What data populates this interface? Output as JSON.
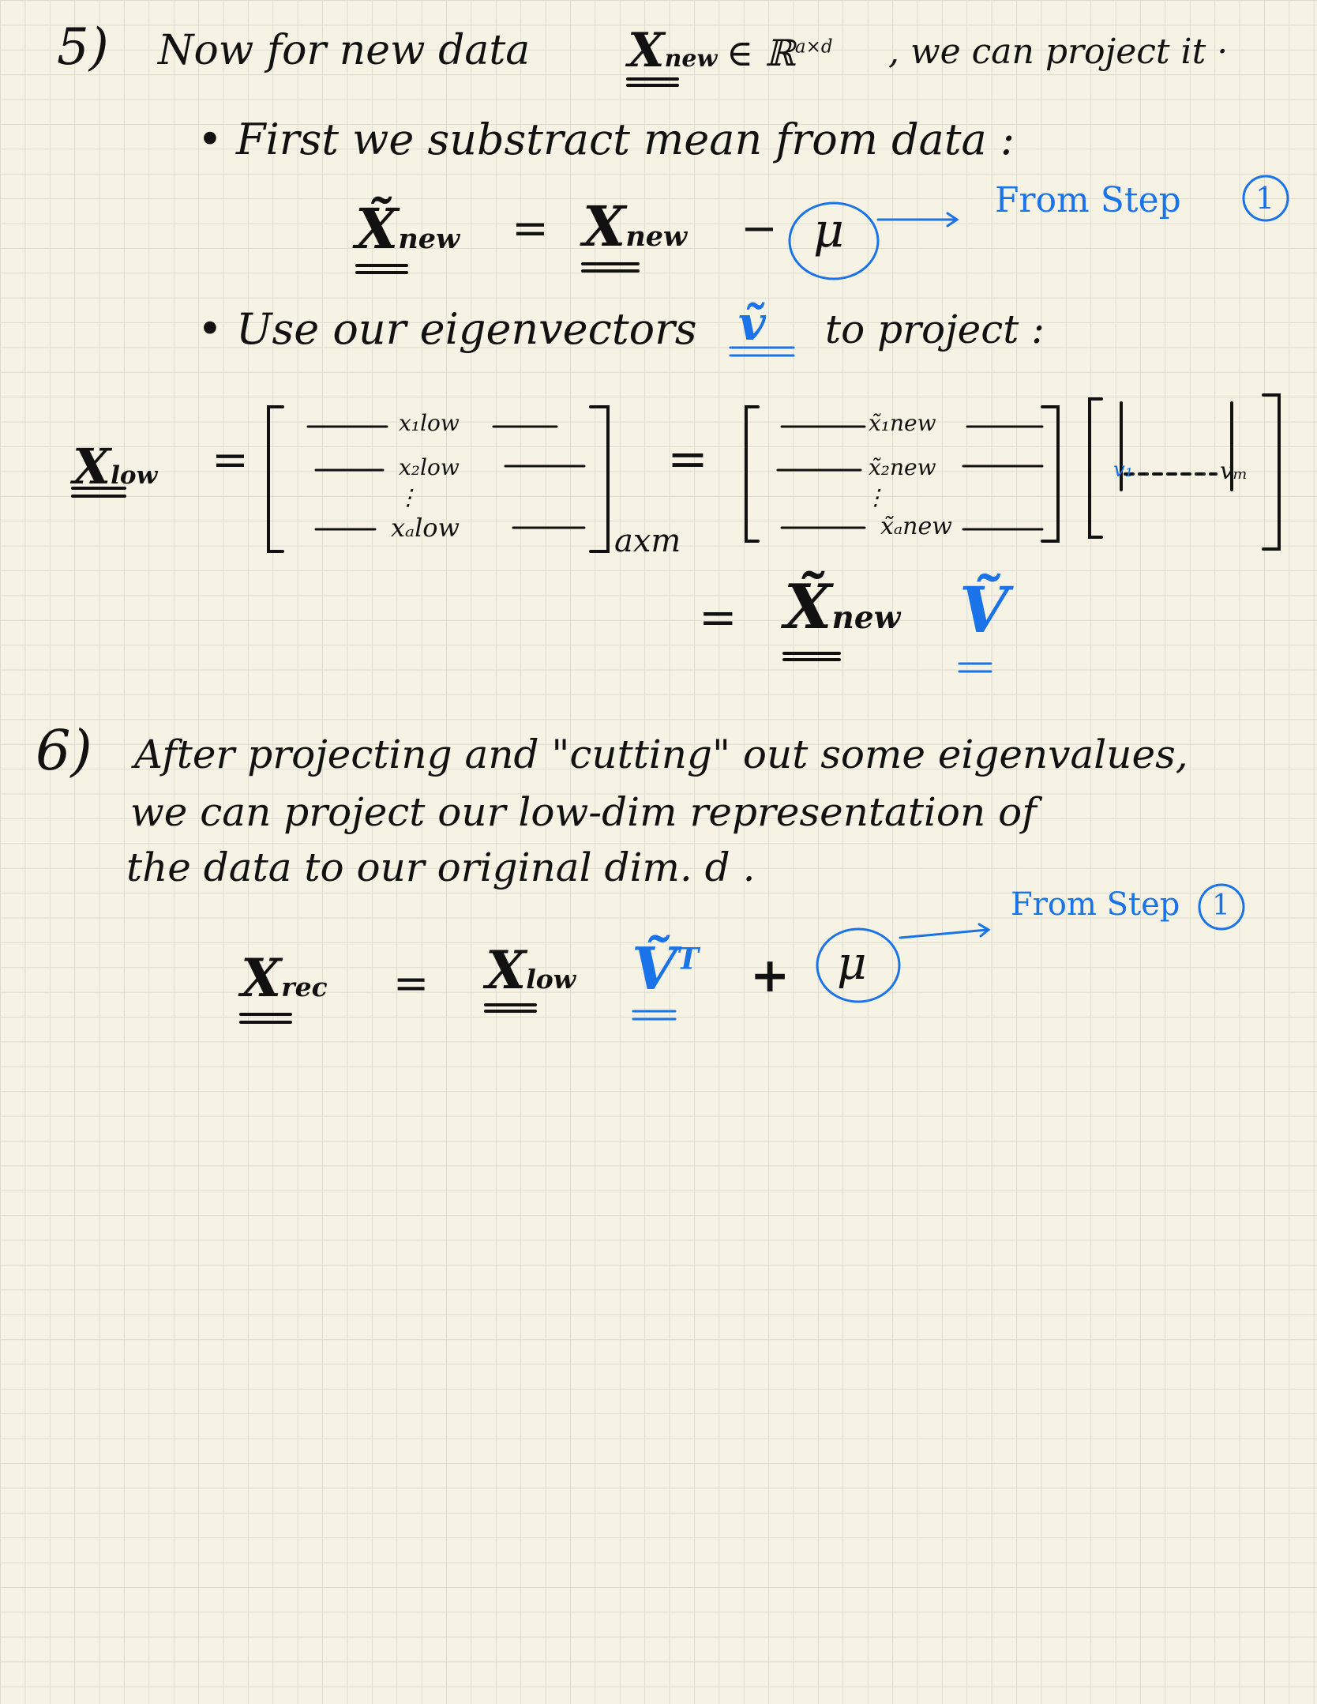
{
  "step5": {
    "num": "5)",
    "text1": "Now for new data",
    "x_new": "X",
    "x_new_sub": "new",
    "in_r": "∈ ℝ",
    "dims": "a×d",
    "text2": ", we can project it ·"
  },
  "bullet1": {
    "text": "First we substract mean from data :",
    "lhs": "X̃",
    "lhs_sub": "new",
    "eq": "=",
    "rhs": "X",
    "rhs_sub": "new",
    "minus": "−",
    "mu": "μ",
    "note": "From Step",
    "step": "1"
  },
  "bullet2": {
    "text_a": "Use our eigenvectors",
    "v_symbol": "ṽ",
    "text_b": "to project :"
  },
  "matrix": {
    "lhs": "X",
    "lhs_sub": "low",
    "eq": "=",
    "rows_low": [
      "x₁low",
      "x₂low",
      "xₐlow"
    ],
    "size": "axm",
    "eq2": "=",
    "rows_new": [
      "x̃₁new",
      "x̃₂new",
      "x̃ₐnew"
    ],
    "v1": "v₁",
    "vm": "vₘ",
    "eq3": "=",
    "result": "X̃",
    "result_sub": "new",
    "result_v": "Ṽ"
  },
  "step6": {
    "num": "6)",
    "line1": "After projecting and \"cutting\" out some eigenvalues,",
    "line2": "we can project our low-dim representation of",
    "line3": "the data to our original dim. d .",
    "note": "From Step",
    "step": "1",
    "lhs": "X",
    "lhs_sub": "rec",
    "eq": "=",
    "rhs": "X",
    "rhs_sub": "low",
    "v": "Ṽ",
    "vt": "T",
    "plus": "+",
    "mu": "μ"
  },
  "colors": {
    "ink": "#111111",
    "blue": "#1a73e8",
    "paper": "#f6f3e4",
    "grid": "#dcdccf"
  }
}
